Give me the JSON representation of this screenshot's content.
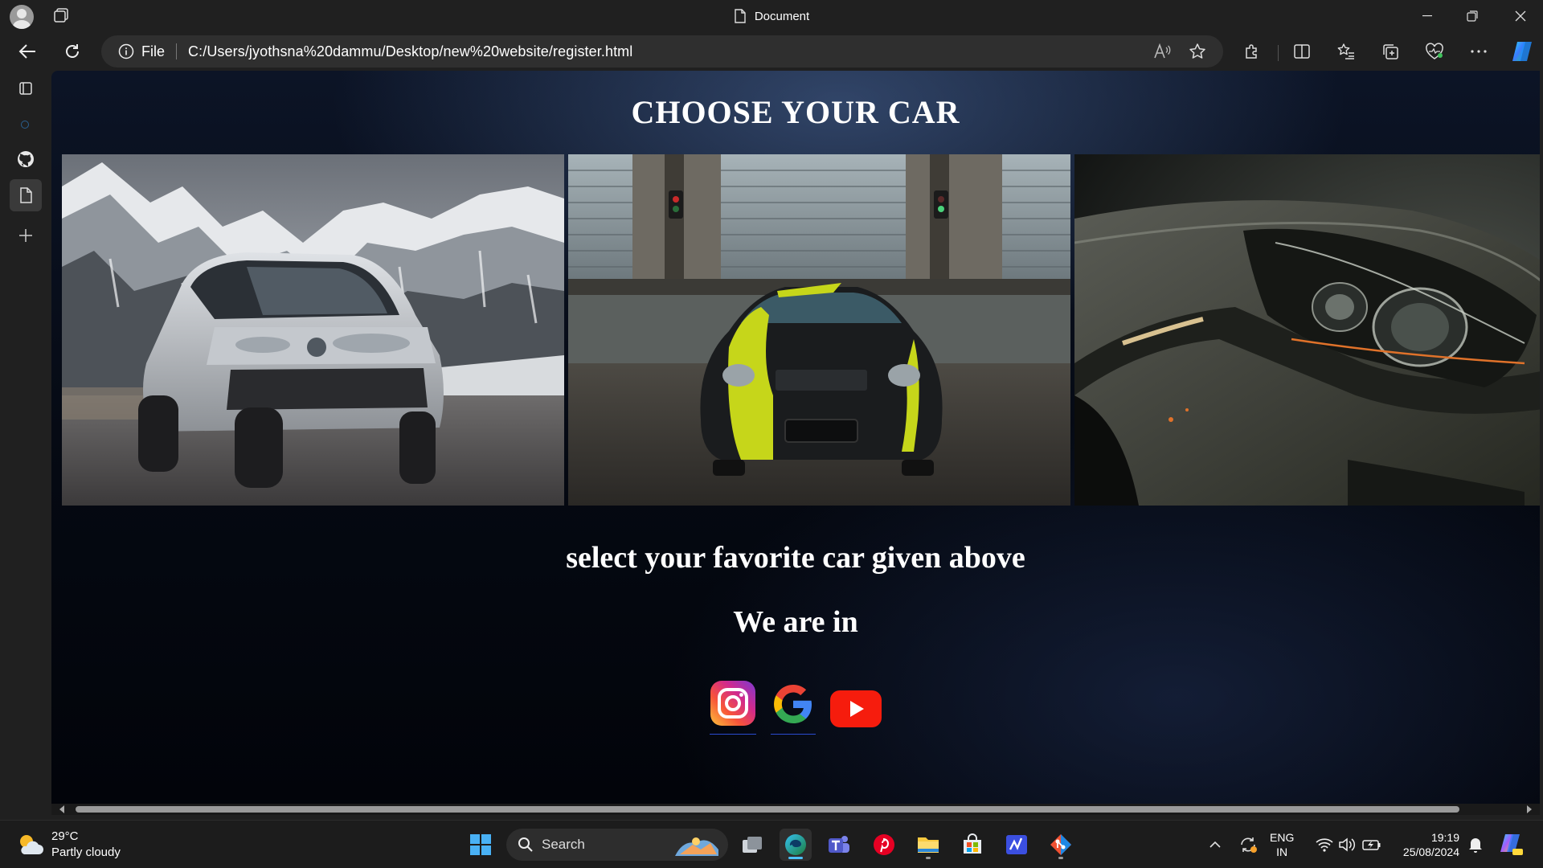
{
  "browser": {
    "window_title": "Document",
    "address": {
      "scheme_label": "File",
      "url": "C:/Users/jyothsna%20dammu/Desktop/new%20website/register.html"
    }
  },
  "page": {
    "heading": "CHOOSE YOUR CAR",
    "images": [
      {
        "subject": "silver SUV in snowy mountains"
      },
      {
        "subject": "black sports car with yellow livery"
      },
      {
        "subject": "car headlight close-up"
      }
    ],
    "prompt": "select your favorite car given above",
    "social_heading": "We are in",
    "social_links": [
      {
        "icon": "instagram-icon"
      },
      {
        "icon": "google-icon"
      },
      {
        "icon": "youtube-icon"
      }
    ]
  },
  "taskbar": {
    "weather": {
      "temp": "29°C",
      "condition": "Partly cloudy"
    },
    "search_label": "Search",
    "language": {
      "line1": "ENG",
      "line2": "IN"
    },
    "clock": {
      "time": "19:19",
      "date": "25/08/2024"
    }
  },
  "colors": {
    "accent": "#4cc2ff",
    "page_bg": "#050912",
    "chrome_bg": "#202020"
  }
}
